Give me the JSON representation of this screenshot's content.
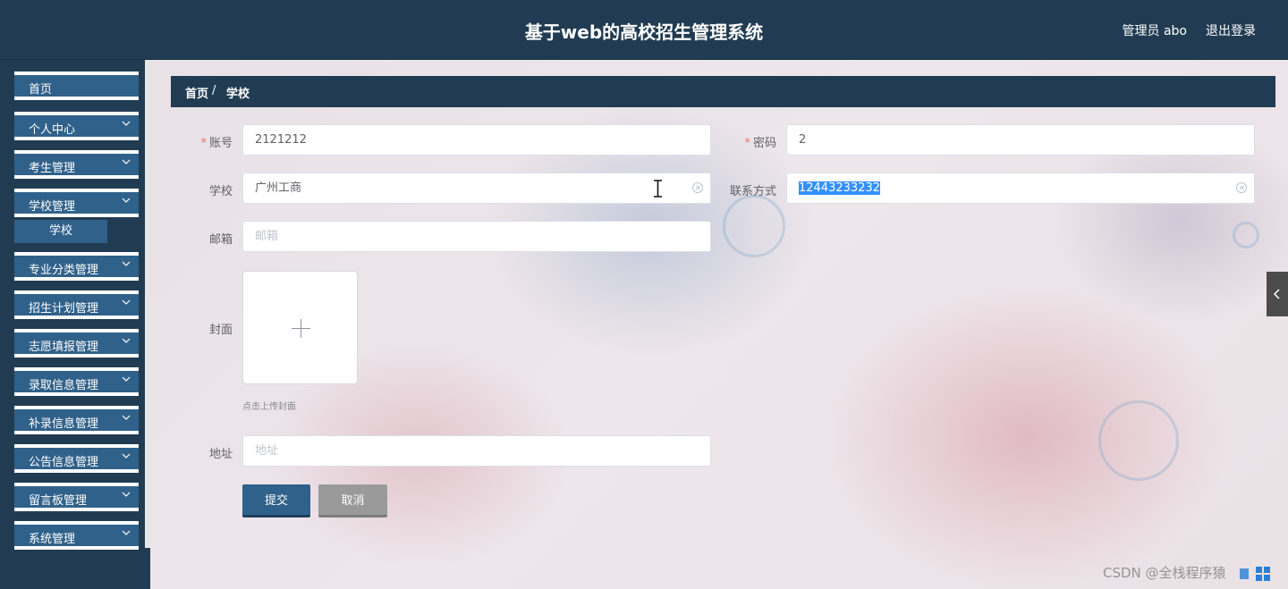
{
  "header": {
    "app_title": "基于web的高校招生管理系统",
    "user_label": "管理员 abo",
    "logout": "退出登录"
  },
  "sidebar": {
    "items": [
      {
        "label": "首页",
        "has_arrow": false
      },
      {
        "label": "个人中心",
        "has_arrow": true
      },
      {
        "label": "考生管理",
        "has_arrow": true
      },
      {
        "label": "学校管理",
        "has_arrow": true
      },
      {
        "label": "专业分类管理",
        "has_arrow": true
      },
      {
        "label": "招生计划管理",
        "has_arrow": true
      },
      {
        "label": "志愿填报管理",
        "has_arrow": true
      },
      {
        "label": "录取信息管理",
        "has_arrow": true
      },
      {
        "label": "补录信息管理",
        "has_arrow": true
      },
      {
        "label": "公告信息管理",
        "has_arrow": true
      },
      {
        "label": "留言板管理",
        "has_arrow": true
      },
      {
        "label": "系统管理",
        "has_arrow": true
      }
    ],
    "sub_item": "学校"
  },
  "breadcrumb": {
    "home": "首页",
    "separator": "/",
    "current": "学校"
  },
  "form": {
    "account_label": "账号",
    "account_value": "2121212",
    "password_label": "密码",
    "password_value": "2",
    "school_label": "学校",
    "school_value": "广州工商",
    "contact_label": "联系方式",
    "contact_value": "12443233232",
    "email_label": "邮箱",
    "email_placeholder": "邮箱",
    "cover_label": "封面",
    "upload_tip": "点击上传封面",
    "address_label": "地址",
    "address_placeholder": "地址",
    "submit": "提交",
    "cancel": "取消",
    "required_mark": "*"
  },
  "watermark": "CSDN @全栈程序猿",
  "colors": {
    "header_bg": "#213c52",
    "menu_bg": "#30618a",
    "cancel_bg": "#9a9a9a",
    "required": "#f56c6c",
    "selection": "#3390ff"
  }
}
